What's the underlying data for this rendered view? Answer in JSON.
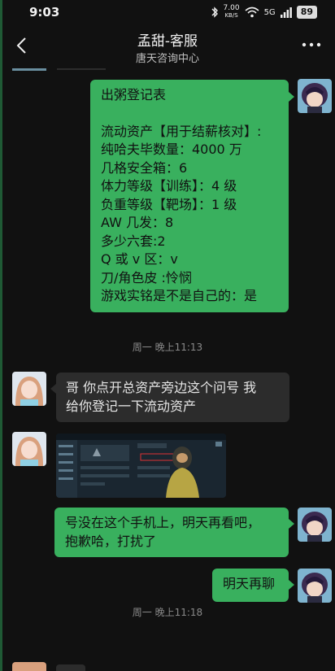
{
  "status_bar": {
    "time": "9:03",
    "net_speed": "7.00",
    "net_unit": "KB/S",
    "signal": "5G",
    "battery": "89"
  },
  "header": {
    "title": "孟甜-客服",
    "subtitle": "唐天咨询中心"
  },
  "messages": {
    "m1": {
      "lines": [
        "出粥登记表",
        "",
        "流动资产【用于结薪核对】:",
        "纯哈夫毕数量：4000 万",
        "几格安全箱：6",
        "体力等级【训练】：4 级",
        "负重等级【靶场】：1 级",
        "AW 几发：8",
        "多少六套:2",
        "Q 或 v 区：v",
        "刀/角色皮 :怜悯",
        "游戏实铭是不是自己的：是"
      ]
    },
    "ts1": "周一 晚上11:13",
    "m2": {
      "line1": "哥 你点开总资产旁边这个问号 我",
      "line2": "给你登记一下流动资产"
    },
    "m4": {
      "line1": "号没在这个手机上，明天再看吧，",
      "line2": "抱歉哈，打扰了"
    },
    "m5": "明天再聊",
    "ts2": "周一 晚上11:18"
  },
  "colors": {
    "background": "#111111",
    "green_bubble": "#39b05e",
    "gray_bubble": "#2c2c2c"
  }
}
